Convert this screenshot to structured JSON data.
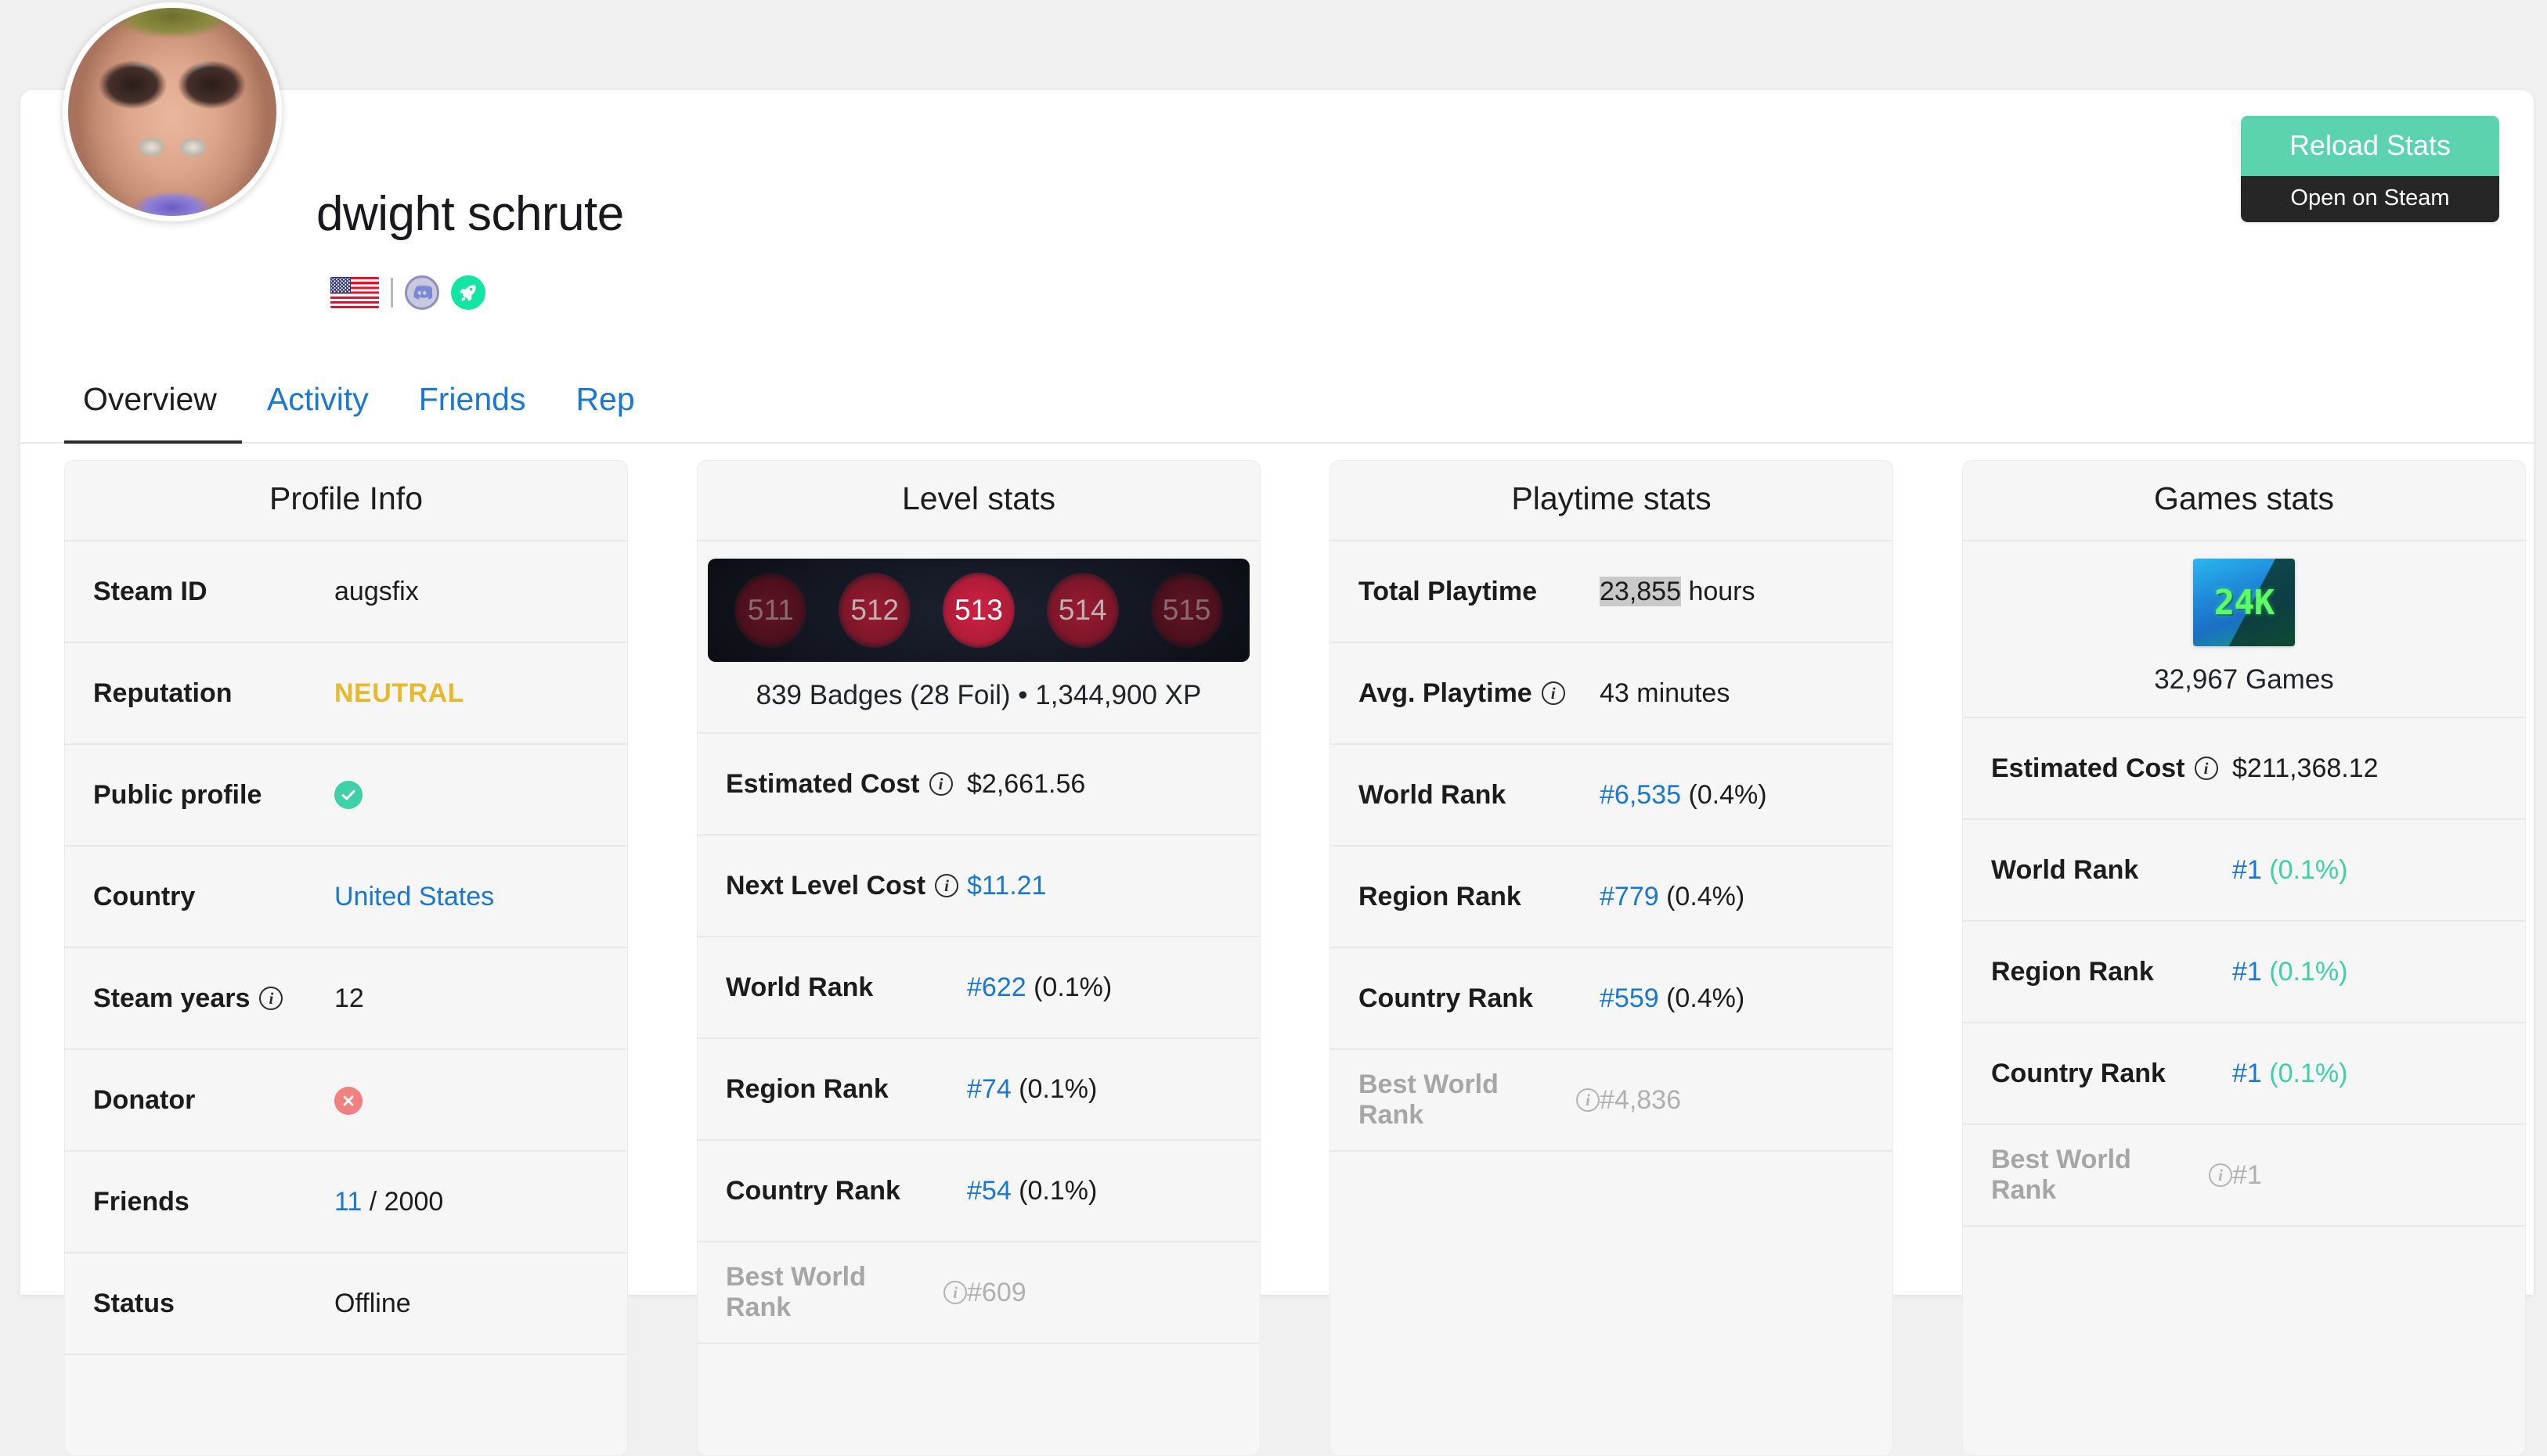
{
  "profile": {
    "username": "dwight schrute",
    "avatar_alt": "profile-avatar",
    "country_flag": "united-states-flag",
    "social": {
      "discord": "discord-icon",
      "rocket": "rocket-icon"
    }
  },
  "actions": {
    "reload_label": "Reload Stats",
    "steam_label": "Open on Steam",
    "reload_color": "#5ad3ae",
    "steam_color": "#262626"
  },
  "tabs": [
    {
      "label": "Overview",
      "active": true
    },
    {
      "label": "Activity",
      "active": false
    },
    {
      "label": "Friends",
      "active": false
    },
    {
      "label": "Rep",
      "active": false
    }
  ],
  "cards": {
    "profile_info": {
      "title": "Profile Info",
      "rows": [
        {
          "label": "Steam ID",
          "value": "augsfix"
        },
        {
          "label": "Reputation",
          "value": "NEUTRAL"
        },
        {
          "label": "Public profile",
          "value": "yes-check"
        },
        {
          "label": "Country",
          "value": "United States"
        },
        {
          "label": "Steam years",
          "value": "12",
          "info": true
        },
        {
          "label": "Donator",
          "value": "no-cross"
        },
        {
          "label": "Friends",
          "value_link": "11",
          "value_rest": " / 2000"
        },
        {
          "label": "Status",
          "value": "Offline"
        }
      ]
    },
    "level_stats": {
      "title": "Level stats",
      "levels": [
        "511",
        "512",
        "513",
        "514",
        "515"
      ],
      "current_level": "513",
      "caption": "839 Badges (28 Foil) • 1,344,900 XP",
      "badges_count": "839",
      "foil_count": "28",
      "xp": "1,344,900",
      "rows": [
        {
          "label": "Estimated Cost",
          "info": true,
          "value": "$2,661.56"
        },
        {
          "label": "Next Level Cost",
          "info": true,
          "value_link": "$11.21"
        },
        {
          "label": "World Rank",
          "value_link": "#622",
          "value_rest": " (0.1%)"
        },
        {
          "label": "Region Rank",
          "value_link": "#74",
          "value_rest": " (0.1%)"
        },
        {
          "label": "Country Rank",
          "value_link": "#54",
          "value_rest": " (0.1%)"
        },
        {
          "label": "Best World Rank",
          "info": true,
          "value": "#609",
          "muted": true
        }
      ]
    },
    "playtime_stats": {
      "title": "Playtime stats",
      "rows": [
        {
          "label": "Total Playtime",
          "value_sel": "23,855",
          "value_rest": " hours"
        },
        {
          "label": "Avg. Playtime",
          "info": true,
          "value": "43 minutes"
        },
        {
          "label": "World Rank",
          "value_link": "#6,535",
          "value_rest": " (0.4%)"
        },
        {
          "label": "Region Rank",
          "value_link": "#779",
          "value_rest": " (0.4%)"
        },
        {
          "label": "Country Rank",
          "value_link": "#559",
          "value_rest": " (0.4%)"
        },
        {
          "label": "Best World Rank",
          "info": true,
          "value": "#4,836",
          "muted": true
        }
      ]
    },
    "games_stats": {
      "title": "Games stats",
      "badge_label": "24K",
      "caption": "32,967 Games",
      "games_count": "32,967",
      "rows": [
        {
          "label": "Estimated Cost",
          "info": true,
          "value": "$211,368.12"
        },
        {
          "label": "World Rank",
          "value_link": "#1",
          "value_pct": " (0.1%)"
        },
        {
          "label": "Region Rank",
          "value_link": "#1",
          "value_pct": " (0.1%)"
        },
        {
          "label": "Country Rank",
          "value_link": "#1",
          "value_pct": " (0.1%)"
        },
        {
          "label": "Best World Rank",
          "info": true,
          "value": "#1",
          "muted": true
        }
      ]
    }
  }
}
